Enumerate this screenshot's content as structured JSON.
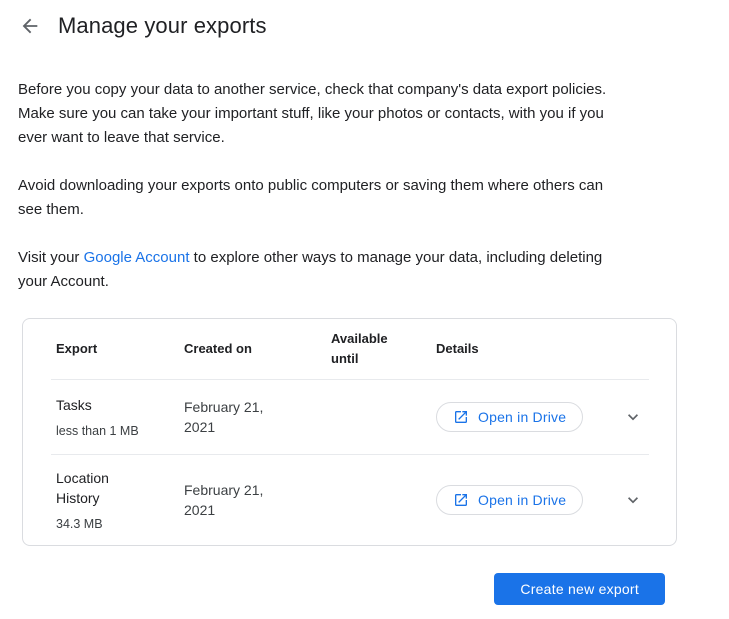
{
  "header": {
    "title": "Manage your exports"
  },
  "intro": {
    "p1": "Before you copy your data to another service, check that company's data export policies.\nMake sure you can take your important stuff, like your photos or contacts, with you if you\never want to leave that service.",
    "p2": "Avoid downloading your exports onto public computers or saving them where others can\nsee them.",
    "p3_prefix": "Visit your ",
    "p3_link": "Google Account",
    "p3_suffix": " to explore other ways to manage your data, including deleting\nyour Account."
  },
  "table": {
    "headers": {
      "export": "Export",
      "created_on": "Created on",
      "available_until": "Available until",
      "details": "Details"
    },
    "rows": [
      {
        "name": "Tasks",
        "size": "less than 1 MB",
        "created": "February 21,\n2021",
        "available_until": "",
        "action_label": "Open in Drive"
      },
      {
        "name": "Location\nHistory",
        "size": "34.3 MB",
        "created": "February 21,\n2021",
        "available_until": "",
        "action_label": "Open in Drive"
      }
    ]
  },
  "footer": {
    "create_button_label": "Create new export"
  },
  "colors": {
    "accent_blue": "#1a73e8",
    "text_primary": "#202124",
    "text_secondary": "#3c4043",
    "icon_gray": "#5f6368",
    "border": "#dadce0",
    "divider": "#e8eaed"
  }
}
